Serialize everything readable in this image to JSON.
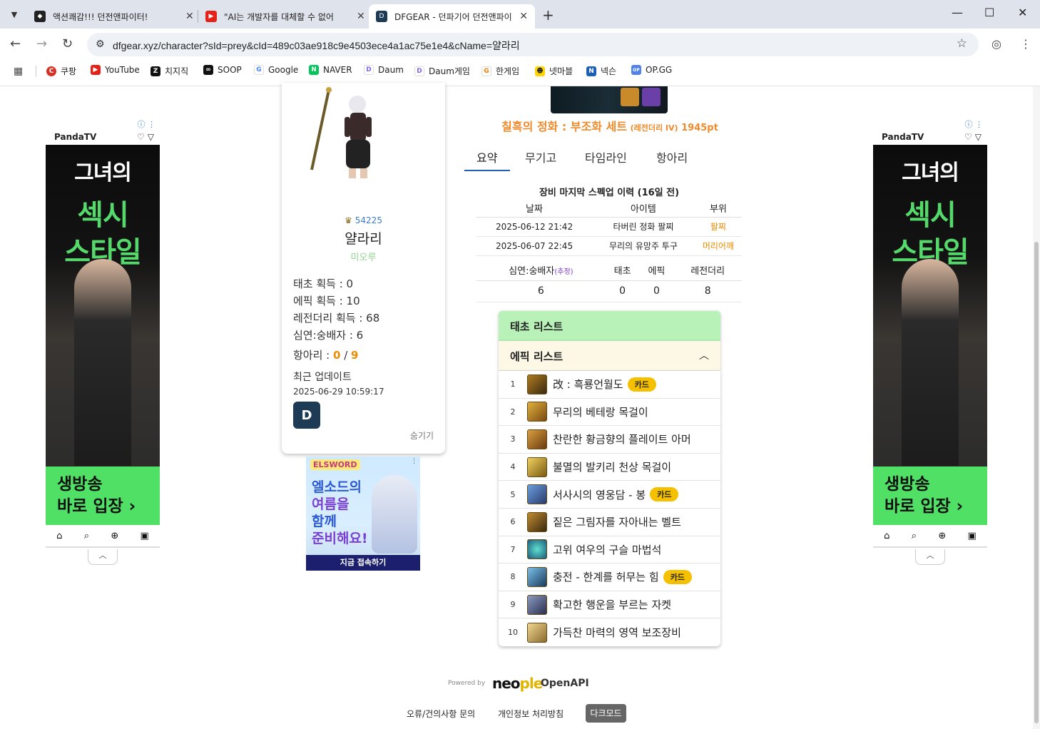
{
  "browser": {
    "tabs": [
      {
        "title": "액션쾌감!!! 던전앤파이터!",
        "active": false
      },
      {
        "title": "\"AI는 개발자를 대체할 수 없어",
        "active": false
      },
      {
        "title": "DFGEAR - 던파기어 던전앤파이",
        "active": true
      }
    ],
    "url": "dfgear.xyz/character?sId=prey&cId=489c03ae918c9e4503ece4a1ac75e1e4&cName=얄라리",
    "bookmarks": [
      "쿠팡",
      "YouTube",
      "치지직",
      "SOOP",
      "Google",
      "NAVER",
      "Daum",
      "Daum게임",
      "한게임",
      "넷마블",
      "넥슨",
      "OP.GG"
    ],
    "colors": {
      "tabbar": "#dfe3eb",
      "omnibox": "#eef1f6"
    }
  },
  "side_ad": {
    "brand": "PandaTV",
    "line1": "그녀의",
    "line2": "섹시",
    "line3": "스타일",
    "cta1": "생방송",
    "cta2": "바로 입장 ›"
  },
  "mid_ad": {
    "brand": "ELSWORD",
    "line1": "엘소드의",
    "line2": "여름을",
    "line3": "함께",
    "line4": "준비해요!",
    "cta": "지금 접속하기"
  },
  "character": {
    "fame": "54225",
    "name": "얄라리",
    "guild": "미오루",
    "stats": {
      "taecho": "태초 획득 : 0",
      "epic": "에픽 획득 : 10",
      "legendary": "레전더리 획득 : 68",
      "simyeon": "심연:숭배자 : 6",
      "hangari_label": "항아리 : ",
      "hangari_cur": "0",
      "hangari_sep": " / ",
      "hangari_max": "9"
    },
    "updated_label": "최근 업데이트",
    "updated_value": "2025-06-29 10:59:17",
    "hide_label": "숨기기",
    "button_glyph": "D"
  },
  "set": {
    "name": "칠흑의 정화 : 부조화 세트",
    "grade": "(레전더리 IV)",
    "points": "1945pt"
  },
  "tabs": [
    {
      "label": "요약",
      "active": true
    },
    {
      "label": "무기고",
      "active": false
    },
    {
      "label": "타임라인",
      "active": false
    },
    {
      "label": "항아리",
      "active": false
    }
  ],
  "history": {
    "title": "장비 마지막 스펙업 이력 (16일 전)",
    "headers": [
      "날짜",
      "아이템",
      "부위"
    ],
    "rows": [
      {
        "date": "2025-06-12 21:42",
        "item": "타버린 정화 팔찌",
        "slot": "팔찌"
      },
      {
        "date": "2025-06-07 22:45",
        "item": "무리의 유망주 투구",
        "slot": "머리어깨"
      }
    ]
  },
  "counts": {
    "headers": {
      "simyeon": "심연:숭배자",
      "hint": "(추정)",
      "taecho": "태초",
      "epic": "에픽",
      "legendary": "레전더리"
    },
    "values": {
      "simyeon": "6",
      "taecho": "0",
      "epic": "0",
      "legendary": "8"
    }
  },
  "taecho_list": {
    "title": "태초 리스트"
  },
  "epic_list": {
    "title": "에픽 리스트",
    "items": [
      {
        "num": "1",
        "name": "改 : 흑룡언월도",
        "badge": "카드"
      },
      {
        "num": "2",
        "name": "무리의 베테랑 목걸이",
        "badge": ""
      },
      {
        "num": "3",
        "name": "찬란한 황금향의 플레이트 아머",
        "badge": ""
      },
      {
        "num": "4",
        "name": "불멸의 발키리 천상 목걸이",
        "badge": ""
      },
      {
        "num": "5",
        "name": "서사시의 영웅담 - 봉",
        "badge": "카드"
      },
      {
        "num": "6",
        "name": "짙은 그림자를 자아내는 벨트",
        "badge": ""
      },
      {
        "num": "7",
        "name": "고위 여우의 구슬 마법석",
        "badge": ""
      },
      {
        "num": "8",
        "name": "충전 - 한계를 허무는 힘",
        "badge": "카드"
      },
      {
        "num": "9",
        "name": "확고한 행운을 부르는 자켓",
        "badge": ""
      },
      {
        "num": "10",
        "name": "가득찬 마력의 영역 보조장비",
        "badge": ""
      }
    ]
  },
  "footer": {
    "powered_by": "Powered by",
    "neople_a": "neo",
    "neople_b": "ple",
    "openapi": "OpenAPI",
    "contact": "오류/건의사항 문의",
    "privacy": "개인정보 처리방침",
    "dark_mode": "다크모드"
  }
}
